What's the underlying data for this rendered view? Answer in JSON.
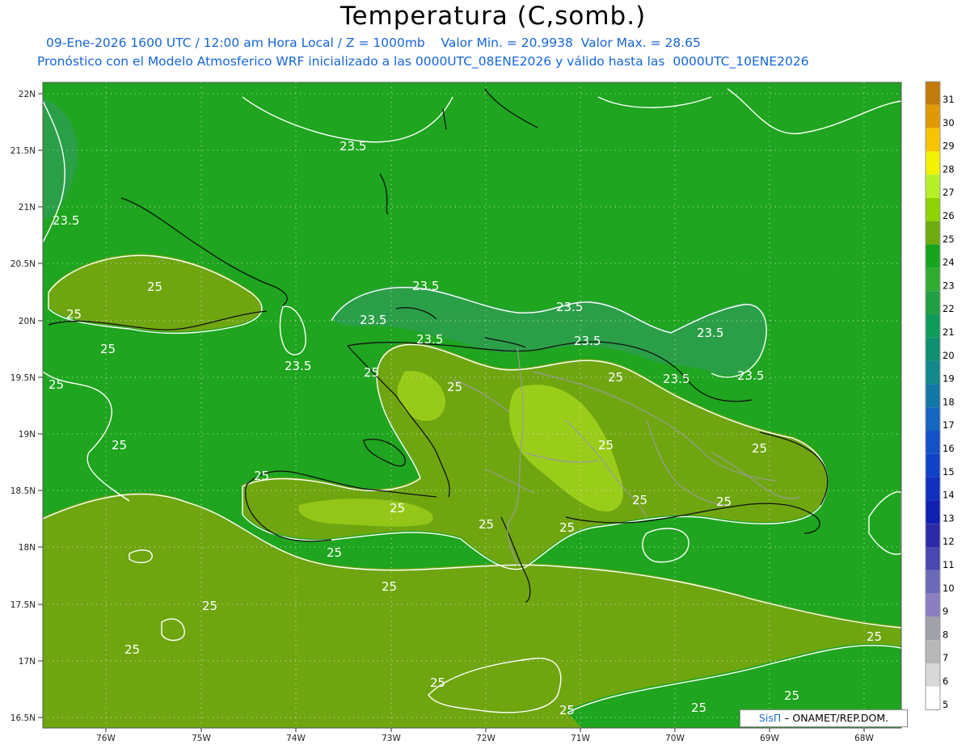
{
  "header": {
    "title": "Temperatura (C,somb.)",
    "subtitle_line1": "09-Ene-2026 1600 UTC / 12:00 am Hora Local / Z = 1000mb    Valor Min. = 20.9938  Valor Max. = 28.65",
    "subtitle_line2": "Pronóstico con el Modelo Atmosferico WRF inicializado a las 0000UTC_08ENE2026 y válido hasta las  0000UTC_10ENE2026"
  },
  "axes": {
    "lat_labels": [
      "22N",
      "21.5N",
      "21N",
      "20.5N",
      "20N",
      "19.5N",
      "19N",
      "18.5N",
      "18N",
      "17.5N",
      "17N",
      "16.5N"
    ],
    "lon_labels": [
      "76W",
      "75W",
      "74W",
      "73W",
      "72W",
      "71W",
      "70W",
      "69W",
      "68W"
    ]
  },
  "contour_labels": {
    "lower": "23.5",
    "upper": "25"
  },
  "colorbar": {
    "labels": [
      "31",
      "30",
      "29",
      "28",
      "27",
      "26",
      "25",
      "24",
      "23",
      "22",
      "21",
      "20",
      "19",
      "18",
      "17",
      "16",
      "15",
      "14",
      "13",
      "12",
      "11",
      "10",
      "9",
      "8",
      "7",
      "6",
      "5"
    ],
    "colors": [
      "#c17b0a",
      "#e09a00",
      "#f7c400",
      "#f2f200",
      "#b6f028",
      "#8ed400",
      "#6faa0e",
      "#16a41e",
      "#30ad30",
      "#21a044",
      "#0e9a58",
      "#0e9070",
      "#12888c",
      "#1278a8",
      "#1466c0",
      "#1452c8",
      "#1042c8",
      "#1030c0",
      "#1020b0",
      "#2a2aa8",
      "#4848b0",
      "#6a6ab8",
      "#8c7ec0",
      "#a0a0a8",
      "#b8b8b8",
      "#d8d8d8",
      "#ffffff"
    ]
  },
  "credit": {
    "brand": "SisΠ",
    "org": " – ONAMET/REP.DOM."
  },
  "colors": {
    "warm_25_26": "#6fa610",
    "base_24_25": "#1fa51f",
    "cool_23": "#2aa544",
    "hot_27": "#a2d41c",
    "coast": "#111111",
    "borders": "#9a9a9a",
    "contour": "#ffffff"
  }
}
